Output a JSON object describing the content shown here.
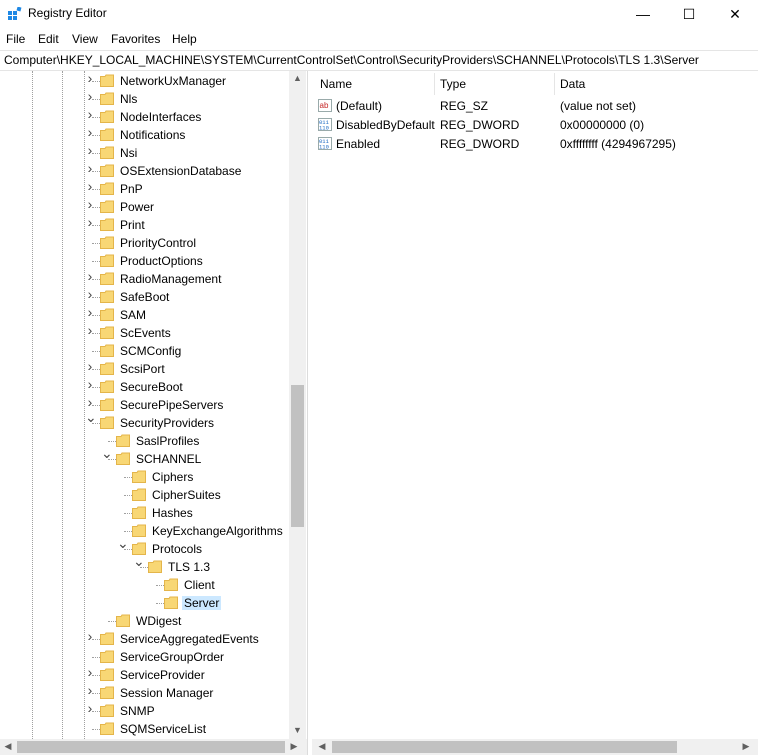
{
  "window": {
    "title": "Registry Editor",
    "minimize": "—",
    "maximize": "☐",
    "close": "✕"
  },
  "menu": [
    "File",
    "Edit",
    "View",
    "Favorites",
    "Help"
  ],
  "address": "Computer\\HKEY_LOCAL_MACHINE\\SYSTEM\\CurrentControlSet\\Control\\SecurityProviders\\SCHANNEL\\Protocols\\TLS 1.3\\Server",
  "tree": [
    {
      "label": "NetworkUxManager",
      "level": 0,
      "expander": ">"
    },
    {
      "label": "Nls",
      "level": 0,
      "expander": ">"
    },
    {
      "label": "NodeInterfaces",
      "level": 0,
      "expander": ">"
    },
    {
      "label": "Notifications",
      "level": 0,
      "expander": ">"
    },
    {
      "label": "Nsi",
      "level": 0,
      "expander": ">"
    },
    {
      "label": "OSExtensionDatabase",
      "level": 0,
      "expander": ">"
    },
    {
      "label": "PnP",
      "level": 0,
      "expander": ">"
    },
    {
      "label": "Power",
      "level": 0,
      "expander": ">"
    },
    {
      "label": "Print",
      "level": 0,
      "expander": ">"
    },
    {
      "label": "PriorityControl",
      "level": 0,
      "expander": ""
    },
    {
      "label": "ProductOptions",
      "level": 0,
      "expander": ""
    },
    {
      "label": "RadioManagement",
      "level": 0,
      "expander": ">"
    },
    {
      "label": "SafeBoot",
      "level": 0,
      "expander": ">"
    },
    {
      "label": "SAM",
      "level": 0,
      "expander": ">"
    },
    {
      "label": "ScEvents",
      "level": 0,
      "expander": ">"
    },
    {
      "label": "SCMConfig",
      "level": 0,
      "expander": ""
    },
    {
      "label": "ScsiPort",
      "level": 0,
      "expander": ">"
    },
    {
      "label": "SecureBoot",
      "level": 0,
      "expander": ">"
    },
    {
      "label": "SecurePipeServers",
      "level": 0,
      "expander": ">"
    },
    {
      "label": "SecurityProviders",
      "level": 0,
      "expander": "v"
    },
    {
      "label": "SaslProfiles",
      "level": 1,
      "expander": ""
    },
    {
      "label": "SCHANNEL",
      "level": 1,
      "expander": "v"
    },
    {
      "label": "Ciphers",
      "level": 2,
      "expander": ""
    },
    {
      "label": "CipherSuites",
      "level": 2,
      "expander": ""
    },
    {
      "label": "Hashes",
      "level": 2,
      "expander": ""
    },
    {
      "label": "KeyExchangeAlgorithms",
      "level": 2,
      "expander": ""
    },
    {
      "label": "Protocols",
      "level": 2,
      "expander": "v"
    },
    {
      "label": "TLS 1.3",
      "level": 3,
      "expander": "v"
    },
    {
      "label": "Client",
      "level": 4,
      "expander": ""
    },
    {
      "label": "Server",
      "level": 4,
      "expander": "",
      "selected": true
    },
    {
      "label": "WDigest",
      "level": 1,
      "expander": ""
    },
    {
      "label": "ServiceAggregatedEvents",
      "level": 0,
      "expander": ">"
    },
    {
      "label": "ServiceGroupOrder",
      "level": 0,
      "expander": ""
    },
    {
      "label": "ServiceProvider",
      "level": 0,
      "expander": ">"
    },
    {
      "label": "Session Manager",
      "level": 0,
      "expander": ">"
    },
    {
      "label": "SNMP",
      "level": 0,
      "expander": ">"
    },
    {
      "label": "SQMServiceList",
      "level": 0,
      "expander": ""
    }
  ],
  "columns": {
    "name": "Name",
    "type": "Type",
    "data": "Data"
  },
  "values": [
    {
      "name": "(Default)",
      "type": "REG_SZ",
      "data": "(value not set)",
      "icon": "string-value-icon"
    },
    {
      "name": "DisabledByDefault",
      "type": "REG_DWORD",
      "data": "0x00000000 (0)",
      "icon": "binary-value-icon"
    },
    {
      "name": "Enabled",
      "type": "REG_DWORD",
      "data": "0xffffffff (4294967295)",
      "icon": "binary-value-icon"
    }
  ],
  "colors": {
    "selection": "#cce8ff",
    "folder": "#f8d775",
    "folder_edge": "#e4b54a",
    "scroll_track": "#f0f0f0",
    "scroll_thumb": "#c1c1c1"
  }
}
